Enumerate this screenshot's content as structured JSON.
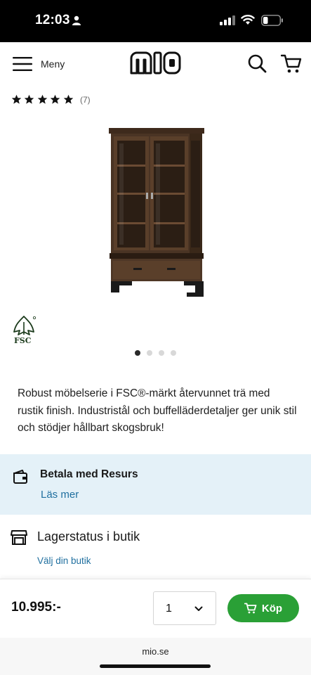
{
  "status_bar": {
    "time": "12:03",
    "icons": [
      "person-icon",
      "signal-icon",
      "wifi-icon",
      "battery-icon"
    ]
  },
  "header": {
    "menu_label": "Meny",
    "logo_text": "mio",
    "icons": [
      "hamburger-icon",
      "search-icon",
      "cart-icon"
    ]
  },
  "rating": {
    "stars": 5,
    "count": "(7)"
  },
  "product": {
    "image": "glass-door-cabinet",
    "badge": "FSC",
    "gallery_total": 4,
    "gallery_active": 1,
    "description": "Robust möbelserie i FSC®-märkt återvunnet trä med rustik finish. Industristål och buffelläderdetaljer ger unik stil och stödjer hållbart skogsbruk!"
  },
  "payment": {
    "title": "Betala med Resurs",
    "link": "Läs mer",
    "background": "#e4f1f8"
  },
  "stock": {
    "title": "Lagerstatus i butik",
    "link": "Välj din butik"
  },
  "purchase": {
    "price": "10.995:-",
    "quantity": "1",
    "buy_label": "Köp",
    "buy_color": "#2aa036"
  },
  "browser": {
    "url": "mio.se"
  },
  "colors": {
    "link": "#1f6f9f"
  }
}
